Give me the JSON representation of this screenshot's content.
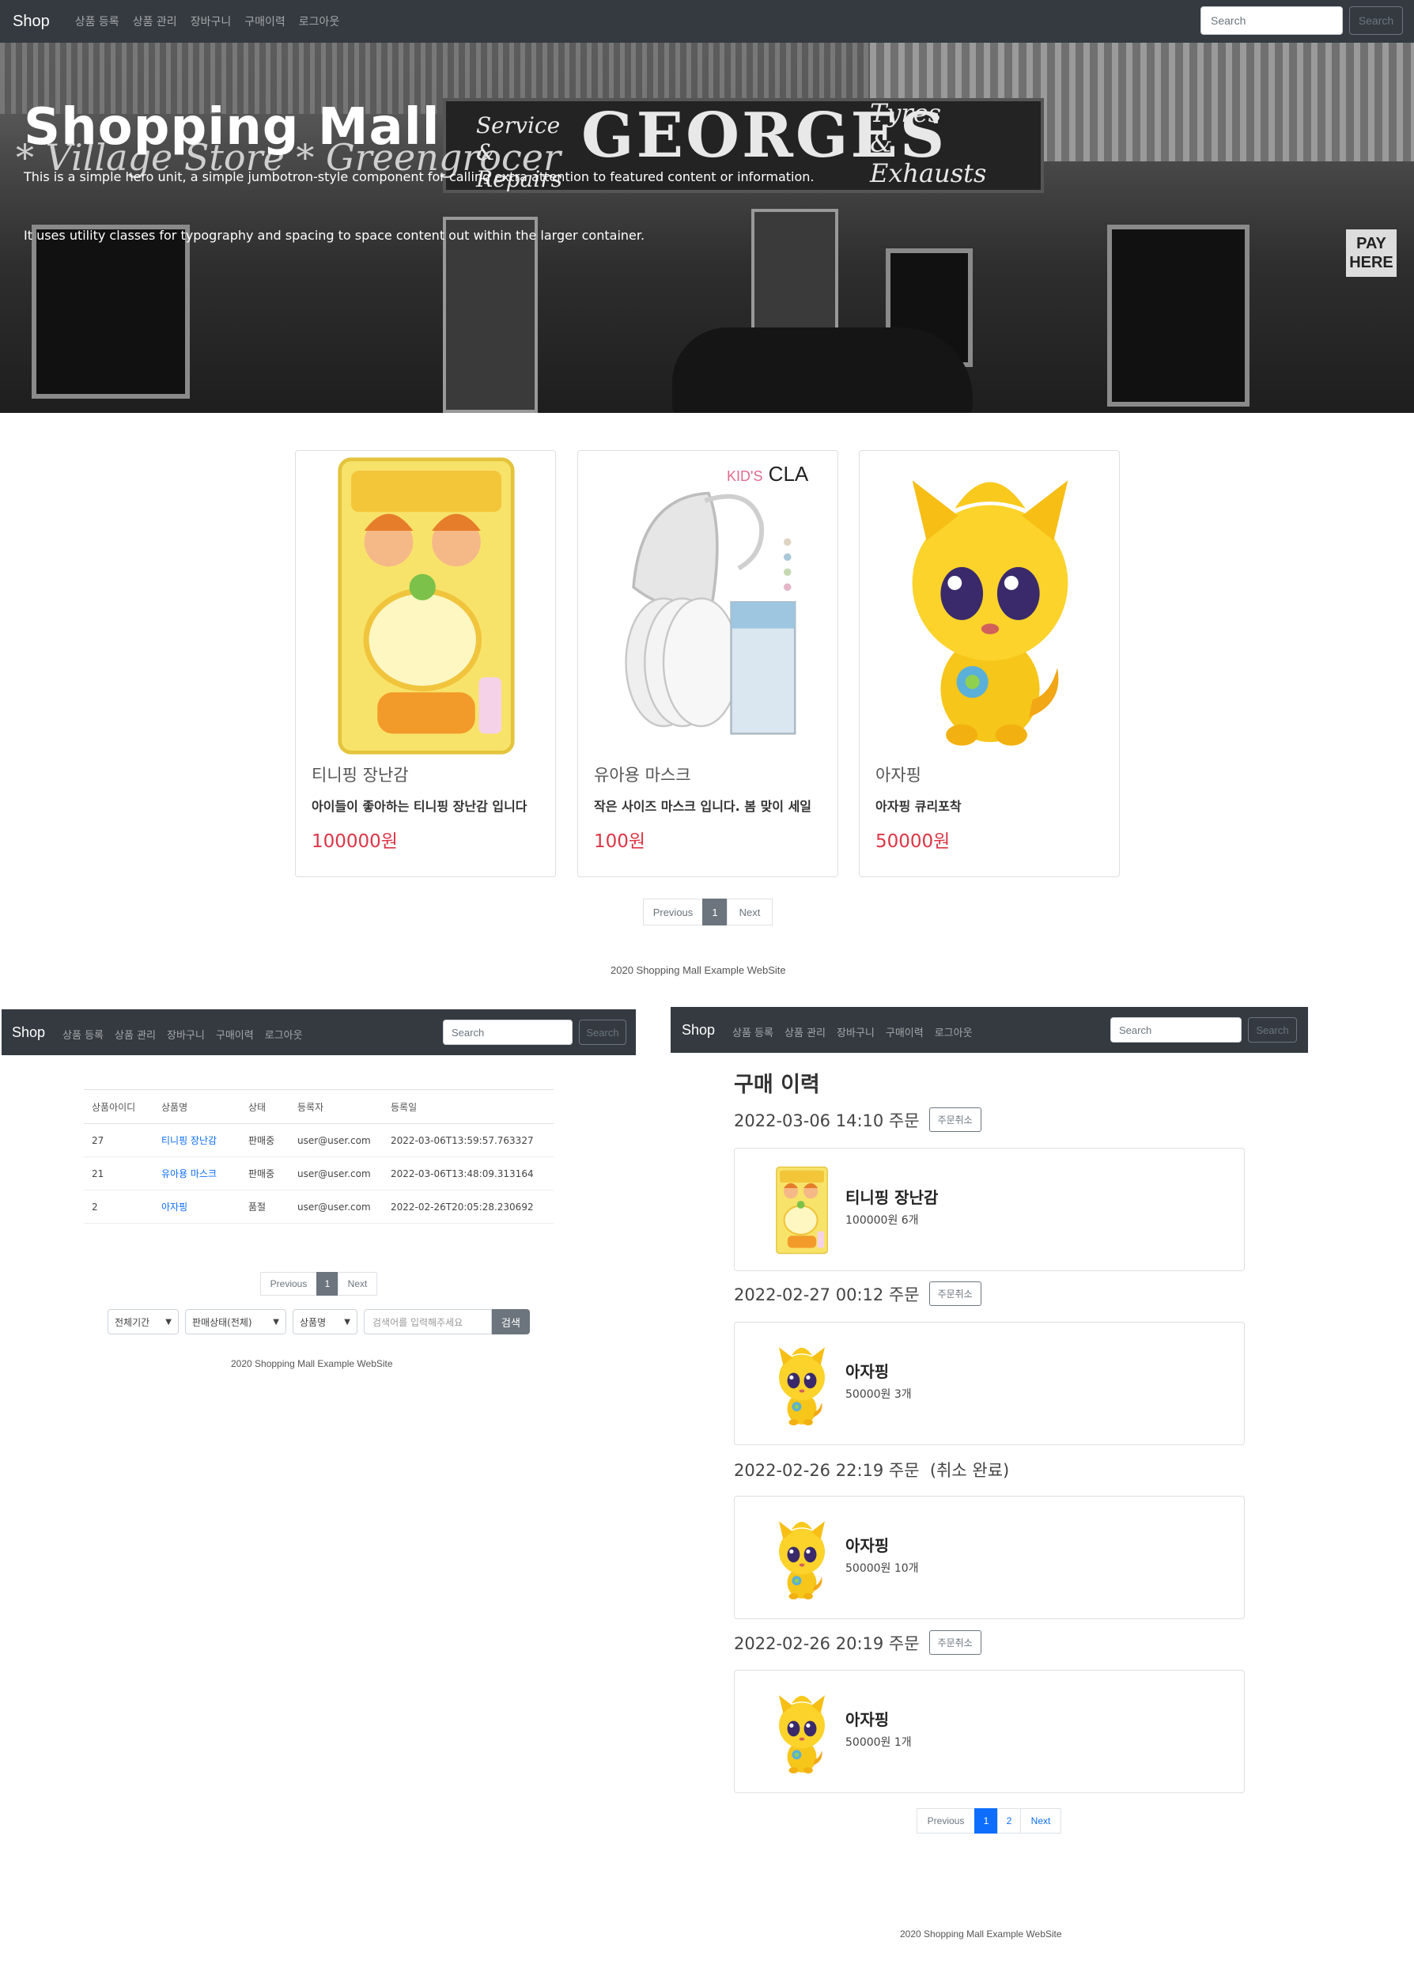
{
  "nav": {
    "brand": "Shop",
    "links": [
      "상품 등록",
      "상품 관리",
      "장바구니",
      "구매이력",
      "로그아웃"
    ],
    "search_placeholder": "Search",
    "search_button": "Search"
  },
  "hero": {
    "title": "Shopping Mall",
    "lead1": "This is a simple hero unit, a simple jumbotron-style component for calling extra attention to featured content or information.",
    "lead2": "It uses utility classes for typography and spacing to space content out within the larger container.",
    "sign_georges": "GEORGES",
    "sign_service": "Service & Repairs",
    "sign_tyres": "Tyres & Exhausts",
    "sign_village": "* Village Store * Greengrocer",
    "sign_pay": "PAY HERE"
  },
  "products": [
    {
      "name": "티니핑 장난감",
      "desc": "아이들이 좋아하는 티니핑 장난감 입니다",
      "price": "100000원",
      "image": "toy-package-image"
    },
    {
      "name": "유아용 마스크",
      "desc": "작은 사이즈 마스크 입니다. 봄 맞이 세일",
      "price": "100원",
      "image": "kids-mask-image",
      "brand": "KID'S CLA"
    },
    {
      "name": "아자핑",
      "desc": "아자핑 큐리포착",
      "price": "50000원",
      "image": "ajaping-character-image"
    }
  ],
  "pagination_main": {
    "previous": "Previous",
    "pages": [
      "1"
    ],
    "next": "Next"
  },
  "footer": "2020 Shopping Mall Example WebSite",
  "admin": {
    "columns": [
      "상품아이디",
      "상품명",
      "상태",
      "등록자",
      "등록일"
    ],
    "rows": [
      {
        "id": "27",
        "name": "티니핑 장난감",
        "status": "판매중",
        "user": "user@user.com",
        "date": "2022-03-06T13:59:57.763327"
      },
      {
        "id": "21",
        "name": "유아용 마스크",
        "status": "판매중",
        "user": "user@user.com",
        "date": "2022-03-06T13:48:09.313164"
      },
      {
        "id": "2",
        "name": "아자핑",
        "status": "품절",
        "user": "user@user.com",
        "date": "2022-02-26T20:05:28.230692"
      }
    ],
    "pagination": {
      "previous": "Previous",
      "pages": [
        "1"
      ],
      "next": "Next"
    },
    "filters": {
      "period": "전체기간",
      "sell_status": "판매상태(전체)",
      "search_by": "상품명"
    },
    "search_placeholder": "검색어를 입력해주세요",
    "search_button": "검색"
  },
  "history": {
    "title": "구매 이력",
    "orders": [
      {
        "header": "2022-03-06 14:10 주문",
        "cancel": "주문취소",
        "item": "티니핑 장난감",
        "detail": "100000원 6개",
        "image": "toy-package-image"
      },
      {
        "header": "2022-02-27 00:12 주문",
        "cancel": "주문취소",
        "item": "아자핑",
        "detail": "50000원 3개",
        "image": "ajaping-character-image"
      },
      {
        "header": "2022-02-26 22:19 주문  (취소 완료)",
        "cancel": "",
        "item": "아자핑",
        "detail": "50000원 10개",
        "image": "ajaping-character-image"
      },
      {
        "header": "2022-02-26 20:19 주문",
        "cancel": "주문취소",
        "item": "아자핑",
        "detail": "50000원 1개",
        "image": "ajaping-character-image"
      }
    ],
    "pagination": {
      "previous": "Previous",
      "pages": [
        "1",
        "2"
      ],
      "next": "Next"
    }
  },
  "colors": {
    "navbar": "#343a40",
    "price": "#dc3545",
    "link": "#0d6efd",
    "secondary": "#6c757d"
  }
}
